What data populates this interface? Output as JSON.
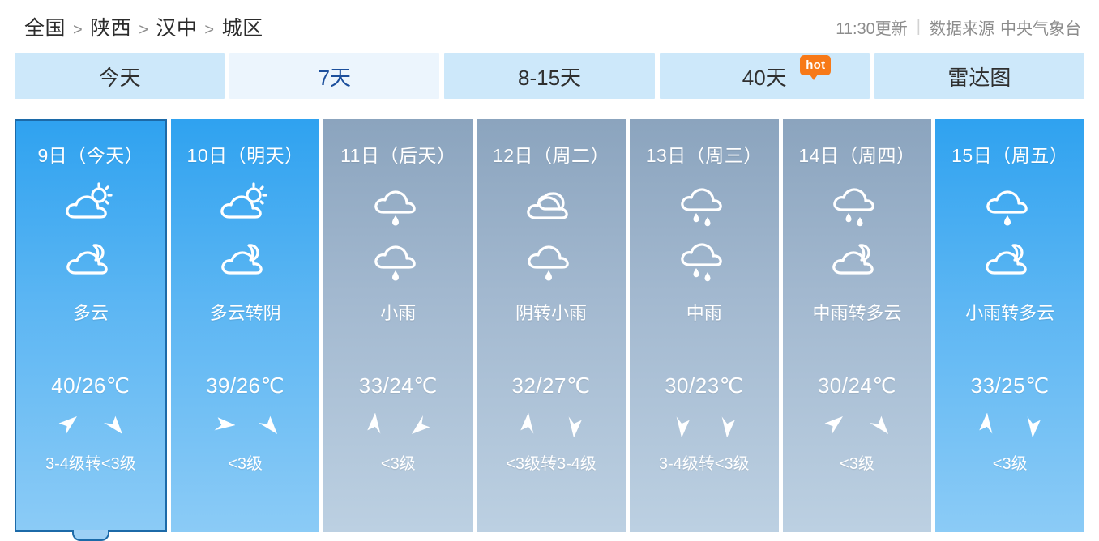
{
  "header": {
    "breadcrumb": [
      "全国",
      "陕西",
      "汉中",
      "城区"
    ],
    "separator": ">",
    "update_time": "11:30更新",
    "meta_divider": "|",
    "source_label": "数据来源",
    "source_name": "中央气象台"
  },
  "tabs": [
    {
      "label": "今天",
      "style": "normal",
      "badge": null
    },
    {
      "label": "7天",
      "style": "light",
      "current": true,
      "badge": null
    },
    {
      "label": "8-15天",
      "style": "normal",
      "badge": null
    },
    {
      "label": "40天",
      "style": "normal",
      "badge": "hot"
    },
    {
      "label": "雷达图",
      "style": "normal",
      "badge": null
    }
  ],
  "colors": {
    "tab_bg": "#cde8fa",
    "tab_bg_light": "#ecf5fd",
    "current_tab_text": "#1c4f9c",
    "hot_badge": "#f77918",
    "selected_border": "#1c6aa8",
    "sunny_card_top": "#2fa2f0",
    "sunny_card_bottom": "#8bcbf6",
    "rain_card_top": "#8ba4be",
    "rain_card_bottom": "#bcd0e2"
  },
  "forecast": {
    "days": [
      {
        "date": "9日（今天）",
        "icon_day": "partly-cloudy-day-icon",
        "icon_night": "cloudy-night-icon",
        "desc": "多云",
        "temp": "40/26℃",
        "wind_arrow_1": "arrow-up-left-icon",
        "wind_arrow_2": "arrow-up-right-icon",
        "wind": "3-4级转<3级",
        "theme": "sunny",
        "selected": true
      },
      {
        "date": "10日（明天）",
        "icon_day": "partly-cloudy-day-icon",
        "icon_night": "cloudy-night-icon",
        "desc": "多云转阴",
        "temp": "39/26℃",
        "wind_arrow_1": "arrow-up-icon",
        "wind_arrow_2": "arrow-up-right-icon",
        "wind": "<3级",
        "theme": "sunny",
        "selected": false
      },
      {
        "date": "11日（后天）",
        "icon_day": "light-rain-icon",
        "icon_night": "light-rain-icon",
        "desc": "小雨",
        "temp": "33/24℃",
        "wind_arrow_1": "arrow-left-icon",
        "wind_arrow_2": "arrow-down-right-icon",
        "wind": "<3级",
        "theme": "rain",
        "selected": false
      },
      {
        "date": "12日（周二）",
        "icon_day": "overcast-icon",
        "icon_night": "light-rain-icon",
        "desc": "阴转小雨",
        "temp": "32/27℃",
        "wind_arrow_1": "arrow-left-icon",
        "wind_arrow_2": "arrow-right-icon",
        "wind": "<3级转3-4级",
        "theme": "rain",
        "selected": false
      },
      {
        "date": "13日（周三）",
        "icon_day": "moderate-rain-icon",
        "icon_night": "moderate-rain-icon",
        "desc": "中雨",
        "temp": "30/23℃",
        "wind_arrow_1": "arrow-right-icon",
        "wind_arrow_2": "arrow-right-icon",
        "wind": "3-4级转<3级",
        "theme": "rain",
        "selected": false
      },
      {
        "date": "14日（周四）",
        "icon_day": "moderate-rain-icon",
        "icon_night": "cloudy-night-icon",
        "desc": "中雨转多云",
        "temp": "30/24℃",
        "wind_arrow_1": "arrow-up-left-icon",
        "wind_arrow_2": "arrow-up-right-icon",
        "wind": "<3级",
        "theme": "rain",
        "selected": false
      },
      {
        "date": "15日（周五）",
        "icon_day": "light-rain-icon",
        "icon_night": "cloudy-night-icon",
        "desc": "小雨转多云",
        "temp": "33/25℃",
        "wind_arrow_1": "arrow-left-icon",
        "wind_arrow_2": "arrow-right-icon",
        "wind": "<3级",
        "theme": "sunny",
        "selected": false
      }
    ]
  }
}
